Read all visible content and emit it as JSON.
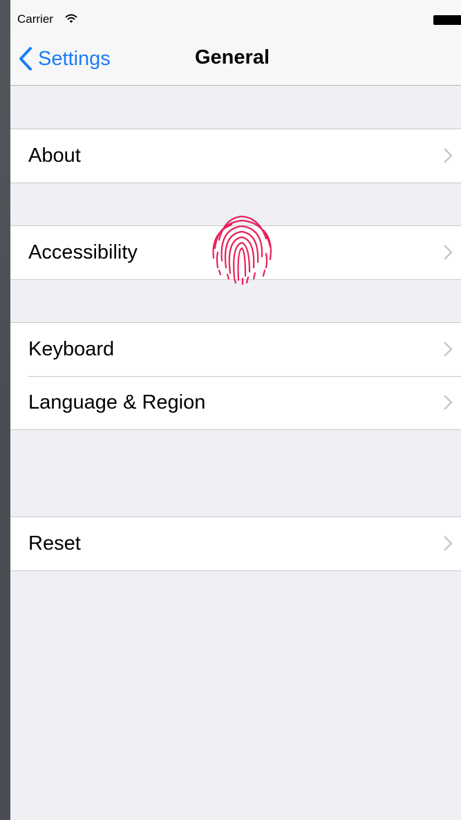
{
  "status_bar": {
    "carrier": "Carrier",
    "wifi_icon": "wifi-icon",
    "battery_icon": "battery-icon"
  },
  "nav_bar": {
    "back_label": "Settings",
    "title": "General"
  },
  "groups": [
    {
      "rows": [
        {
          "label": "About"
        }
      ]
    },
    {
      "rows": [
        {
          "label": "Accessibility"
        }
      ]
    },
    {
      "rows": [
        {
          "label": "Keyboard"
        },
        {
          "label": "Language & Region"
        }
      ]
    },
    {
      "rows": [
        {
          "label": "Reset"
        }
      ]
    }
  ],
  "colors": {
    "accent": "#1a7cf8",
    "background": "#efeff4",
    "touch_indicator": "#e8205a"
  },
  "touch_indicator_icon": "fingerprint-icon"
}
